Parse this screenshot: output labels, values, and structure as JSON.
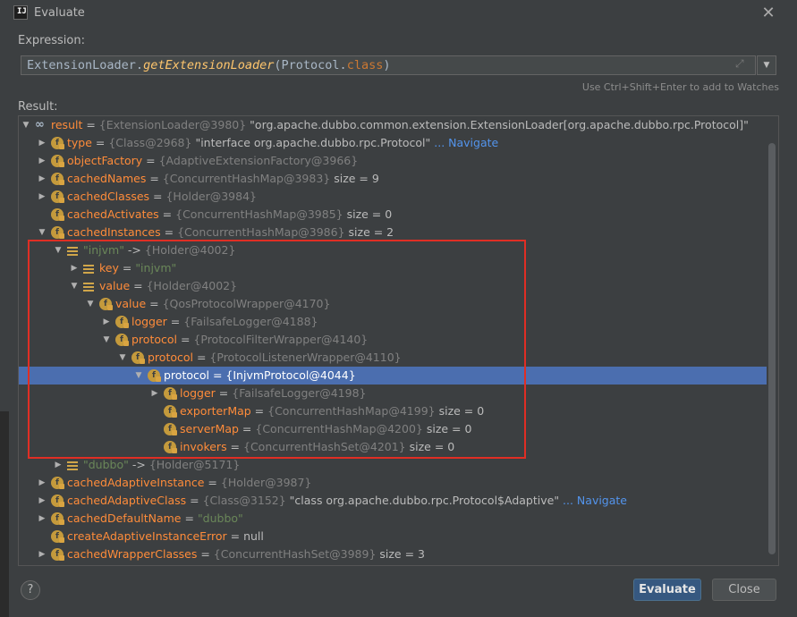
{
  "window": {
    "title": "Evaluate",
    "app_icon": "IJ"
  },
  "expression": {
    "label": "Expression:",
    "class_name": "ExtensionLoader",
    "dot1": ".",
    "method": "getExtensionLoader",
    "open_paren": "(",
    "arg_class": "Protocol",
    "dot2": ".",
    "keyword": "class",
    "close_paren": ")"
  },
  "hint": "Use Ctrl+Shift+Enter to add to Watches",
  "result_label": "Result:",
  "tree": {
    "rows": [
      {
        "indent": 0,
        "arrow": "down",
        "icon": "oo",
        "name": "result",
        "value": "{ExtensionLoader@3980}",
        "extra": "\"org.apache.dubbo.common.extension.ExtensionLoader[org.apache.dubbo.rpc.Protocol]\""
      },
      {
        "indent": 1,
        "arrow": "right",
        "icon": "field",
        "name": "type",
        "value": "{Class@2968}",
        "extra": "\"interface org.apache.dubbo.rpc.Protocol\"",
        "nav": "... Navigate"
      },
      {
        "indent": 1,
        "arrow": "right",
        "icon": "field",
        "name": "objectFactory",
        "value": "{AdaptiveExtensionFactory@3966}"
      },
      {
        "indent": 1,
        "arrow": "right",
        "icon": "field",
        "name": "cachedNames",
        "value": "{ConcurrentHashMap@3983}",
        "extra": " size = 9"
      },
      {
        "indent": 1,
        "arrow": "right",
        "icon": "field",
        "name": "cachedClasses",
        "value": "{Holder@3984}"
      },
      {
        "indent": 1,
        "arrow": "none",
        "icon": "field",
        "name": "cachedActivates",
        "value": "{ConcurrentHashMap@3985}",
        "extra": " size = 0"
      },
      {
        "indent": 1,
        "arrow": "down",
        "icon": "field",
        "name": "cachedInstances",
        "value": "{ConcurrentHashMap@3986}",
        "extra": " size = 2"
      },
      {
        "indent": 2,
        "arrow": "down",
        "icon": "list",
        "key": "\"injvm\"",
        "arrowtxt": "->",
        "value": "{Holder@4002}"
      },
      {
        "indent": 3,
        "arrow": "right",
        "icon": "list",
        "name": "key",
        "value": "\"injvm\"",
        "string": true
      },
      {
        "indent": 3,
        "arrow": "down",
        "icon": "list",
        "name": "value",
        "value": "{Holder@4002}"
      },
      {
        "indent": 4,
        "arrow": "down",
        "icon": "field",
        "name": "value",
        "value": "{QosProtocolWrapper@4170}"
      },
      {
        "indent": 5,
        "arrow": "right",
        "icon": "field",
        "name": "logger",
        "value": "{FailsafeLogger@4188}"
      },
      {
        "indent": 5,
        "arrow": "down",
        "icon": "field",
        "name": "protocol",
        "value": "{ProtocolFilterWrapper@4140}"
      },
      {
        "indent": 6,
        "arrow": "down",
        "icon": "field",
        "name": "protocol",
        "value": "{ProtocolListenerWrapper@4110}"
      },
      {
        "indent": 7,
        "arrow": "down",
        "icon": "field",
        "name": "protocol",
        "value": "{InjvmProtocol@4044}",
        "selected": true
      },
      {
        "indent": 8,
        "arrow": "right",
        "icon": "field",
        "name": "logger",
        "value": "{FailsafeLogger@4198}"
      },
      {
        "indent": 8,
        "arrow": "none",
        "icon": "field",
        "name": "exporterMap",
        "value": "{ConcurrentHashMap@4199}",
        "extra": " size = 0"
      },
      {
        "indent": 8,
        "arrow": "none",
        "icon": "field",
        "name": "serverMap",
        "value": "{ConcurrentHashMap@4200}",
        "extra": " size = 0"
      },
      {
        "indent": 8,
        "arrow": "none",
        "icon": "field",
        "name": "invokers",
        "value": "{ConcurrentHashSet@4201}",
        "extra": " size = 0"
      },
      {
        "indent": 2,
        "arrow": "right",
        "icon": "list",
        "key": "\"dubbo\"",
        "arrowtxt": "->",
        "value": "{Holder@5171}"
      },
      {
        "indent": 1,
        "arrow": "right",
        "icon": "field",
        "name": "cachedAdaptiveInstance",
        "value": "{Holder@3987}"
      },
      {
        "indent": 1,
        "arrow": "right",
        "icon": "field",
        "name": "cachedAdaptiveClass",
        "value": "{Class@3152}",
        "extra": "\"class org.apache.dubbo.rpc.Protocol$Adaptive\"",
        "nav": "... Navigate"
      },
      {
        "indent": 1,
        "arrow": "right",
        "icon": "field",
        "name": "cachedDefaultName",
        "value": "\"dubbo\"",
        "string": true
      },
      {
        "indent": 1,
        "arrow": "none",
        "icon": "field",
        "name": "createAdaptiveInstanceError",
        "value": "null",
        "plain": true
      },
      {
        "indent": 1,
        "arrow": "right",
        "icon": "field",
        "name": "cachedWrapperClasses",
        "value": "{ConcurrentHashSet@3989}",
        "extra": " size = 3"
      }
    ]
  },
  "buttons": {
    "evaluate": "Evaluate",
    "close": "Close",
    "help": "?"
  },
  "colors": {
    "selection": "#4b6eaf",
    "highlight_box": "#e02e24",
    "field_icon": "#c49a3c",
    "name": "#ff8c3a",
    "string": "#6a8759",
    "link": "#5394ec"
  }
}
